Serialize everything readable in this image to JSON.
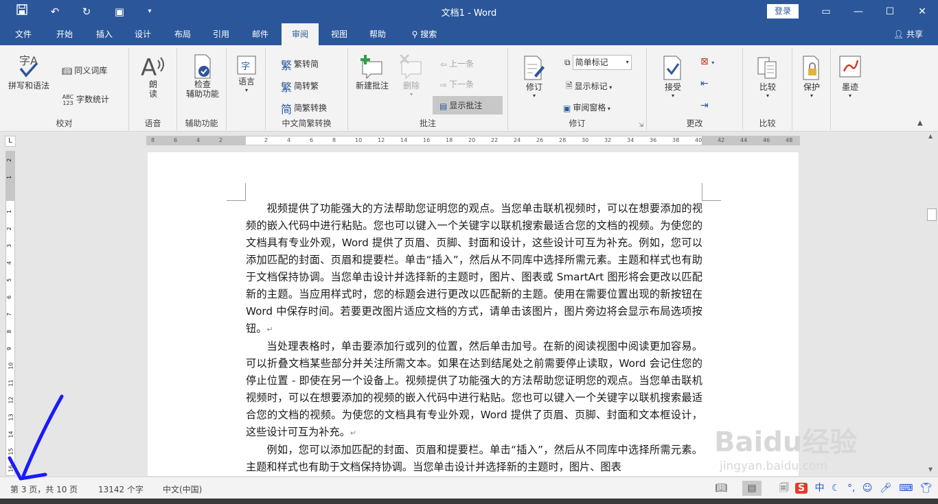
{
  "window": {
    "title": "文档1 - Word",
    "login_label": "登录",
    "share_label": "共享"
  },
  "menu": {
    "tabs": [
      "文件",
      "开始",
      "插入",
      "设计",
      "布局",
      "引用",
      "邮件",
      "审阅",
      "视图",
      "帮助",
      "搜索"
    ],
    "active_tab": "审阅"
  },
  "ribbon": {
    "proofing": {
      "label": "校对",
      "spelling": "拼写和语法",
      "thesaurus": "同义词库",
      "word_count": "字数统计"
    },
    "speech": {
      "label": "语音",
      "read_aloud": "朗\n读"
    },
    "accessibility": {
      "label": "辅助功能",
      "check": "检查\n辅助功能"
    },
    "language": {
      "label": "语言"
    },
    "chinese_conversion": {
      "label": "中文简繁转换",
      "to_simplified": "繁转简",
      "to_traditional": "简转繁",
      "convert": "简繁转换"
    },
    "comments": {
      "label": "批注",
      "new_comment": "新建批注",
      "delete": "删除",
      "previous": "上一条",
      "next": "下一条",
      "show_comments": "显示批注"
    },
    "tracking": {
      "label": "修订",
      "track_changes": "修订",
      "markup_select": "简单标记",
      "show_markup": "显示标记",
      "reviewing_pane": "审阅窗格"
    },
    "changes": {
      "label": "更改",
      "accept": "接受"
    },
    "compare": {
      "label": "比较",
      "compare": "比较"
    },
    "protect": {
      "protect": "保护"
    },
    "ink": {
      "ink": "墨迹"
    }
  },
  "ruler": {
    "h_ticks": [
      "8",
      "6",
      "4",
      "2",
      "",
      "2",
      "4",
      "6",
      "8",
      "10",
      "12",
      "14",
      "16",
      "18",
      "20",
      "22",
      "24",
      "26",
      "28",
      "30",
      "32",
      "34",
      "36",
      "38",
      "40",
      "42",
      "44",
      "46",
      "48"
    ],
    "v_ticks": [
      "2",
      "1",
      "",
      "1",
      "2",
      "3",
      "4",
      "5",
      "6",
      "7",
      "8",
      "9",
      "10",
      "11",
      "12",
      "13",
      "14",
      "15",
      "16"
    ]
  },
  "document": {
    "paragraphs": [
      "视频提供了功能强大的方法帮助您证明您的观点。当您单击联机视频时，可以在想要添加的视频的嵌入代码中进行粘贴。您也可以键入一个关键字以联机搜索最适合您的文档的视频。为使您的文档具有专业外观，Word 提供了页眉、页脚、封面和设计，这些设计可互为补充。例如，您可以添加匹配的封面、页眉和提要栏。单击“插入”，然后从不同库中选择所需元素。主题和样式也有助于文档保持协调。当您单击设计并选择新的主题时，图片、图表或 SmartArt 图形将会更改以匹配新的主题。当应用样式时，您的标题会进行更改以匹配新的主题。使用在需要位置出现的新按钮在 Word 中保存时间。若要更改图片适应文档的方式，请单击该图片，图片旁边将会显示布局选项按钮。",
      "当处理表格时，单击要添加行或列的位置，然后单击加号。在新的阅读视图中阅读更加容易。可以折叠文档某些部分并关注所需文本。如果在达到结尾处之前需要停止读取，Word 会记住您的停止位置 - 即使在另一个设备上。视频提供了功能强大的方法帮助您证明您的观点。当您单击联机视频时，可以在想要添加的视频的嵌入代码中进行粘贴。您也可以键入一个关键字以联机搜索最适合您的文档的视频。为使您的文档具有专业外观，Word 提供了页眉、页脚、封面和文本框设计，这些设计可互为补充。",
      "例如，您可以添加匹配的封面、页眉和提要栏。单击“插入”，然后从不同库中选择所需元素。主题和样式也有助于文档保持协调。当您单击设计并选择新的主题时，图片、图表"
    ],
    "para_mark": "↵"
  },
  "status": {
    "page": "第 3 页，共 10 页",
    "words": "13142 个字",
    "language": "中文(中国)"
  },
  "ime": {
    "s_logo": "S",
    "lang": "中"
  },
  "watermark": {
    "main": "Baidu经验",
    "sub": "jingyan.baidu.com"
  },
  "colors": {
    "title_bar": "#2b579a",
    "ribbon": "#f3f3f3",
    "accent": "#2b579a",
    "arrow": "#1a1aff"
  }
}
